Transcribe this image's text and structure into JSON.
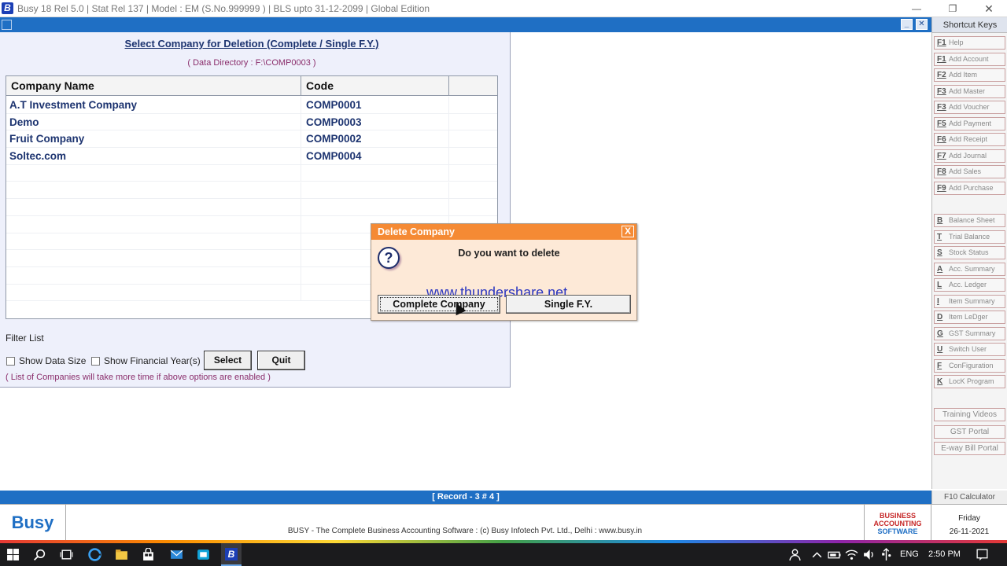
{
  "window": {
    "title": "Busy 18  Rel 5.0  |  Stat Rel 137  |  Model : EM (S.No.999999 )  |  BLS upto 31-12-2099  |  Global Edition",
    "logo_letter": "B"
  },
  "form": {
    "heading": "Select Company for Deletion (Complete / Single F.Y.)",
    "data_directory": "( Data Directory : F:\\COMP0003 )",
    "columns": [
      "Company Name",
      "Code",
      ""
    ],
    "rows": [
      {
        "name": "A.T Investment Company",
        "code": "COMP0001"
      },
      {
        "name": "Demo",
        "code": "COMP0003"
      },
      {
        "name": "Fruit Company",
        "code": "COMP0002"
      },
      {
        "name": "Soltec.com",
        "code": "COMP0004"
      }
    ],
    "filter_label": "Filter List",
    "show_data_size": "Show Data Size",
    "show_financial_years": "Show Financial Year(s)",
    "select_label": "Select",
    "quit_label": "Quit",
    "hint": "( List of Companies will take more time if above options are enabled )"
  },
  "dialog": {
    "title": "Delete Company",
    "close_glyph": "X",
    "message": "Do you want to delete",
    "watermark": "www.thundershare.net",
    "complete_label": "Complete Company",
    "single_label": "Single F.Y."
  },
  "sidebar": {
    "title": "Shortcut Keys",
    "shortcuts": [
      {
        "key": "F1",
        "label": "Help"
      },
      {
        "key": "F1",
        "label": "Add Account"
      },
      {
        "key": "F2",
        "label": "Add Item"
      },
      {
        "key": "F3",
        "label": "Add Master"
      },
      {
        "key": "F3",
        "label": "Add Voucher"
      },
      {
        "key": "F5",
        "label": "Add Payment"
      },
      {
        "key": "F6",
        "label": "Add Receipt"
      },
      {
        "key": "F7",
        "label": "Add Journal"
      },
      {
        "key": "F8",
        "label": "Add Sales"
      },
      {
        "key": "F9",
        "label": "Add Purchase"
      }
    ],
    "reports": [
      {
        "key": "B",
        "label": "Balance Sheet"
      },
      {
        "key": "T",
        "label": "Trial Balance"
      },
      {
        "key": "S",
        "label": "Stock Status"
      },
      {
        "key": "A",
        "label": "Acc. Summary"
      },
      {
        "key": "L",
        "label": "Acc. Ledger"
      },
      {
        "key": "I",
        "label": "Item Summary"
      },
      {
        "key": "D",
        "label": "Item LeDger"
      },
      {
        "key": "G",
        "label": "GST Summary"
      },
      {
        "key": "U",
        "label": "Switch User"
      },
      {
        "key": "F",
        "label": "ConFiguration"
      },
      {
        "key": "K",
        "label": "LocK Program"
      }
    ],
    "links": [
      "Training Videos",
      "GST Portal",
      "E-way Bill Portal"
    ],
    "calculator": "F10 Calculator"
  },
  "status": {
    "record": "[ Record - 3 # 4 ]"
  },
  "footer": {
    "logo": "Busy",
    "copyright": "BUSY - The Complete Business Accounting Software  :  (c) Busy Infotech Pvt. Ltd., Delhi  :  www.busy.in",
    "brand_line1": "BUSINESS",
    "brand_line2": "ACCOUNTING",
    "brand_line3": "SOFTWARE",
    "day": "Friday",
    "date": "26-11-2021"
  },
  "taskbar": {
    "language": "ENG",
    "time": "2:50 PM"
  },
  "colors": {
    "accent_blue": "#1f6fc4",
    "dialog_title": "#f58a34",
    "dialog_body": "#fde9d7",
    "text_navy": "#1d3470",
    "hint_purple": "#8a2d6b"
  }
}
